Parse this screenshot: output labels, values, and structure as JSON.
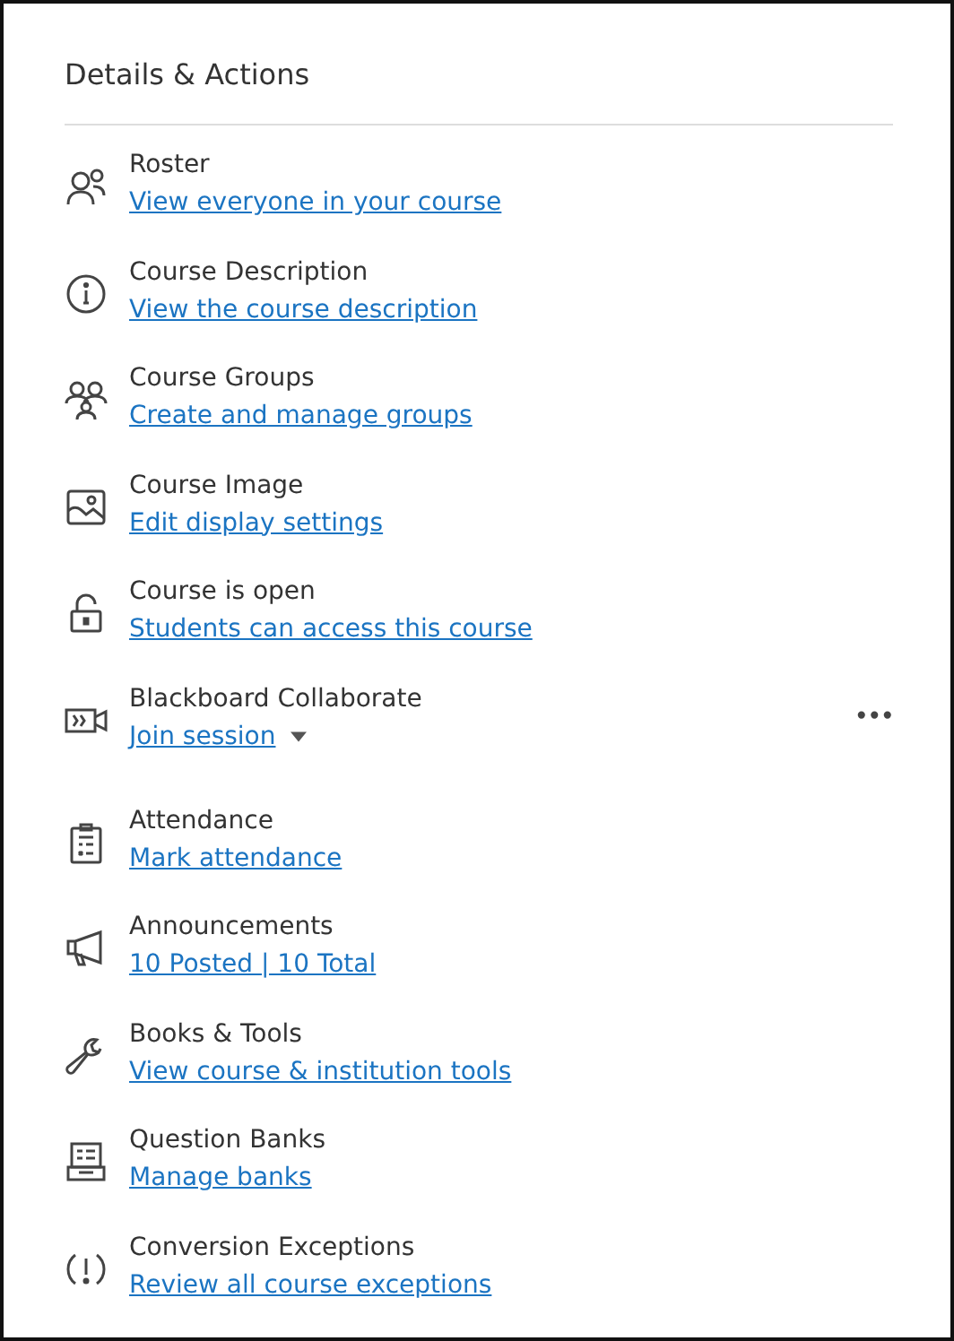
{
  "panel": {
    "title": "Details & Actions"
  },
  "items": [
    {
      "title": "Roster",
      "link": "View everyone in your course"
    },
    {
      "title": "Course Description",
      "link": "View the course description"
    },
    {
      "title": "Course Groups",
      "link": "Create and manage groups"
    },
    {
      "title": "Course Image",
      "link": "Edit display settings"
    },
    {
      "title": "Course is open",
      "link": "Students can access this course"
    },
    {
      "title": "Blackboard Collaborate",
      "link": "Join session",
      "dropdown": true,
      "more": "•••"
    },
    {
      "title": "Attendance",
      "link": "Mark attendance"
    },
    {
      "title": "Announcements",
      "link": "10 Posted | 10 Total"
    },
    {
      "title": "Books & Tools",
      "link": "View course & institution tools"
    },
    {
      "title": "Question Banks",
      "link": "Manage banks"
    },
    {
      "title": "Conversion Exceptions",
      "link": "Review all course exceptions"
    }
  ]
}
